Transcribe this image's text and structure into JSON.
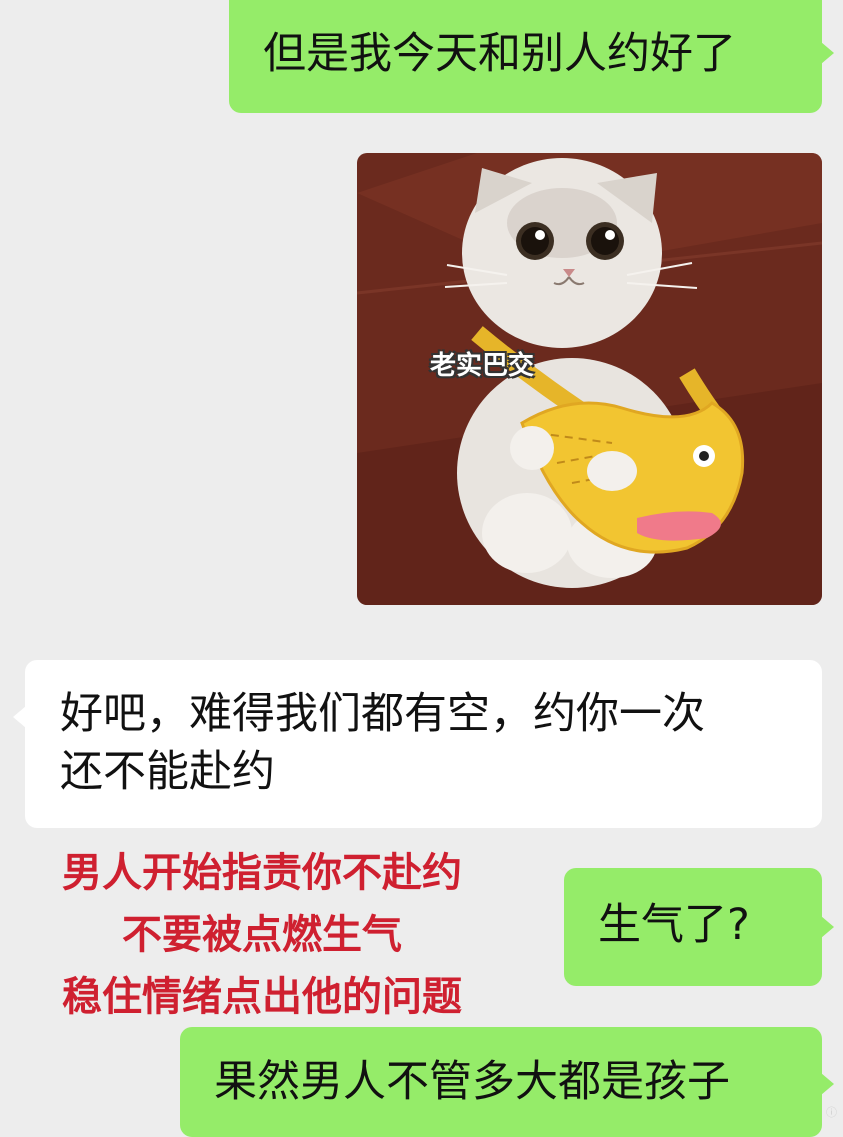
{
  "messages": [
    {
      "side": "out",
      "text": "但是我今天和别人约好了"
    },
    {
      "side": "out",
      "type": "sticker",
      "caption": "老实巴交"
    },
    {
      "side": "in",
      "lines": [
        "好吧，难得我们都有空，约你一次",
        "还不能赴约"
      ]
    },
    {
      "side": "out",
      "text": "生气了?"
    },
    {
      "side": "out",
      "text": "果然男人不管多大都是孩子"
    }
  ],
  "annotation": {
    "lines": [
      "男人开始指责你不赴约",
      "不要被点燃生气",
      "稳住情绪点出他的问题"
    ]
  },
  "colors": {
    "background": "#ededed",
    "outgoing_bubble": "#95ec69",
    "incoming_bubble": "#ffffff",
    "annotation_text": "#cf2030"
  },
  "watermark": "ⓘ"
}
